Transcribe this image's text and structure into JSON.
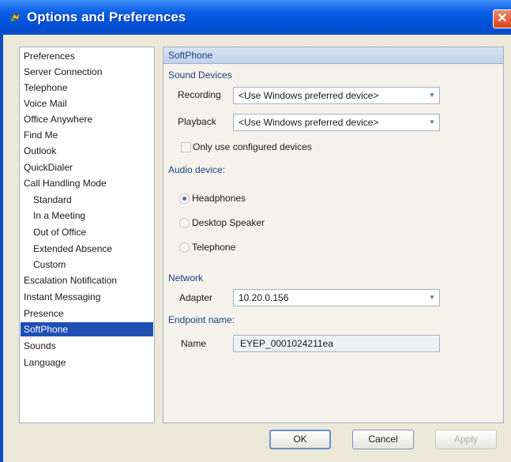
{
  "window": {
    "title": "Options and Preferences",
    "close_glyph": "✕",
    "app_icon": "options-app-icon"
  },
  "tree": {
    "items": [
      {
        "label": "Preferences",
        "child": false,
        "selected": false
      },
      {
        "label": "Server Connection",
        "child": false,
        "selected": false
      },
      {
        "label": "Telephone",
        "child": false,
        "selected": false
      },
      {
        "label": "Voice Mail",
        "child": false,
        "selected": false
      },
      {
        "label": "Office Anywhere",
        "child": false,
        "selected": false
      },
      {
        "label": "Find Me",
        "child": false,
        "selected": false
      },
      {
        "label": "Outlook",
        "child": false,
        "selected": false
      },
      {
        "label": "QuickDialer",
        "child": false,
        "selected": false
      },
      {
        "label": "Call Handling Mode",
        "child": false,
        "selected": false
      },
      {
        "label": "Standard",
        "child": true,
        "selected": false
      },
      {
        "label": "In a Meeting",
        "child": true,
        "selected": false
      },
      {
        "label": "Out of Office",
        "child": true,
        "selected": false
      },
      {
        "label": "Extended Absence",
        "child": true,
        "selected": false
      },
      {
        "label": "Custom",
        "child": true,
        "selected": false
      },
      {
        "label": "Escalation Notification",
        "child": false,
        "selected": false
      },
      {
        "label": "Instant Messaging",
        "child": false,
        "selected": false
      },
      {
        "label": "Presence",
        "child": false,
        "selected": false
      },
      {
        "label": "SoftPhone",
        "child": false,
        "selected": true
      },
      {
        "label": "Sounds",
        "child": false,
        "selected": false
      },
      {
        "label": "Language",
        "child": false,
        "selected": false
      }
    ]
  },
  "panel": {
    "title": "SoftPhone",
    "sound_devices": {
      "heading": "Sound Devices",
      "recording_label": "Recording",
      "recording_value": "<Use Windows preferred device>",
      "playback_label": "Playback",
      "playback_value": "<Use Windows preferred device>",
      "only_configured_label": "Only use configured devices",
      "only_configured_checked": false
    },
    "audio_device": {
      "heading": "Audio device:",
      "options": [
        {
          "label": "Headphones",
          "selected": true
        },
        {
          "label": "Desktop Speaker",
          "selected": false
        },
        {
          "label": "Telephone",
          "selected": false
        }
      ]
    },
    "network": {
      "heading": "Network",
      "adapter_label": "Adapter",
      "adapter_value": "10.20.0.156"
    },
    "endpoint": {
      "heading": "Endpoint name:",
      "name_label": "Name",
      "name_value": "EYEP_0001024211ea"
    }
  },
  "buttons": {
    "ok": "OK",
    "cancel": "Cancel",
    "apply": "Apply"
  },
  "colors": {
    "title_bar": "#0a5ee6",
    "selection": "#1f4fb5",
    "section_heading": "#1f3f88"
  }
}
